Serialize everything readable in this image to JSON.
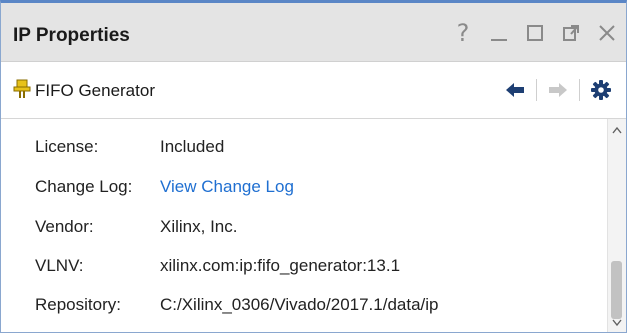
{
  "panel": {
    "title": "IP Properties",
    "window_controls": [
      {
        "name": "help-icon",
        "glyph": "?"
      },
      {
        "name": "minimize-icon"
      },
      {
        "name": "maximize-icon"
      },
      {
        "name": "float-icon"
      },
      {
        "name": "close-icon"
      }
    ]
  },
  "toolbar": {
    "ip_name": "FIFO Generator",
    "ip_icon": "ip-core-icon",
    "back_icon": "arrow-left-icon",
    "forward_icon": "arrow-right-icon",
    "settings_icon": "gear-icon"
  },
  "properties": [
    {
      "label": "License:",
      "value": "Included",
      "is_link": false
    },
    {
      "label": "Change Log:",
      "value": "View Change Log",
      "is_link": true
    },
    {
      "label": "Vendor:",
      "value": "Xilinx, Inc.",
      "is_link": false
    },
    {
      "label": "VLNV:",
      "value": "xilinx.com:ip:fifo_generator:13.1",
      "is_link": false
    },
    {
      "label": "Repository:",
      "value": "C:/Xilinx_0306/Vivado/2017.1/data/ip",
      "is_link": false
    }
  ],
  "colors": {
    "accent_border": "#5a86c6",
    "link": "#1f6fd1",
    "icon_yellow": "#e8c21a",
    "icon_dark_blue": "#1e3f73"
  }
}
